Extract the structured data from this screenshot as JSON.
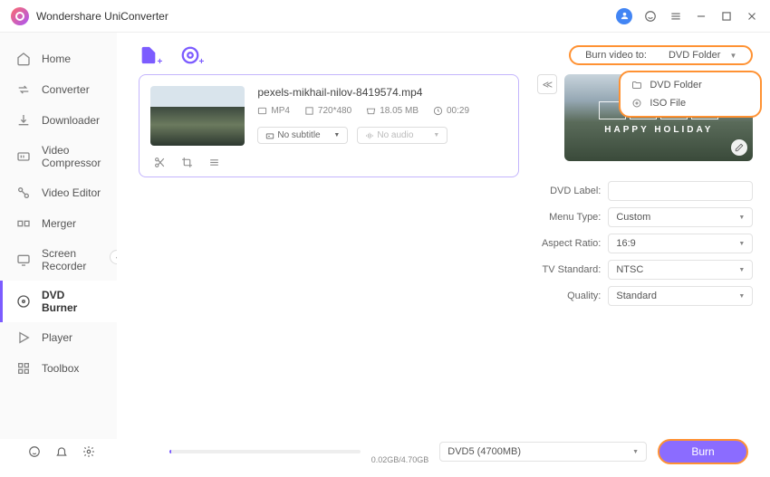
{
  "app": {
    "title": "Wondershare UniConverter"
  },
  "sidebar": {
    "items": [
      {
        "label": "Home"
      },
      {
        "label": "Converter"
      },
      {
        "label": "Downloader"
      },
      {
        "label": "Video Compressor"
      },
      {
        "label": "Video Editor"
      },
      {
        "label": "Merger"
      },
      {
        "label": "Screen Recorder"
      },
      {
        "label": "DVD Burner"
      },
      {
        "label": "Player"
      },
      {
        "label": "Toolbox"
      }
    ]
  },
  "burn_to": {
    "label": "Burn video to:",
    "value": "DVD Folder",
    "options": [
      "DVD Folder",
      "ISO File"
    ]
  },
  "file": {
    "name": "pexels-mikhail-nilov-8419574.mp4",
    "format": "MP4",
    "resolution": "720*480",
    "size": "18.05 MB",
    "duration": "00:29",
    "subtitle": "No subtitle",
    "audio": "No audio"
  },
  "preview": {
    "title": "HAPPY HOLIDAY",
    "sub": ""
  },
  "settings": {
    "dvd_label_label": "DVD Label:",
    "dvd_label_value": "",
    "menu_type_label": "Menu Type:",
    "menu_type_value": "Custom",
    "aspect_ratio_label": "Aspect Ratio:",
    "aspect_ratio_value": "16:9",
    "tv_standard_label": "TV Standard:",
    "tv_standard_value": "NTSC",
    "quality_label": "Quality:",
    "quality_value": "Standard"
  },
  "bottom": {
    "progress_text": "0.02GB/4.70GB",
    "disk": "DVD5 (4700MB)",
    "burn_label": "Burn"
  }
}
